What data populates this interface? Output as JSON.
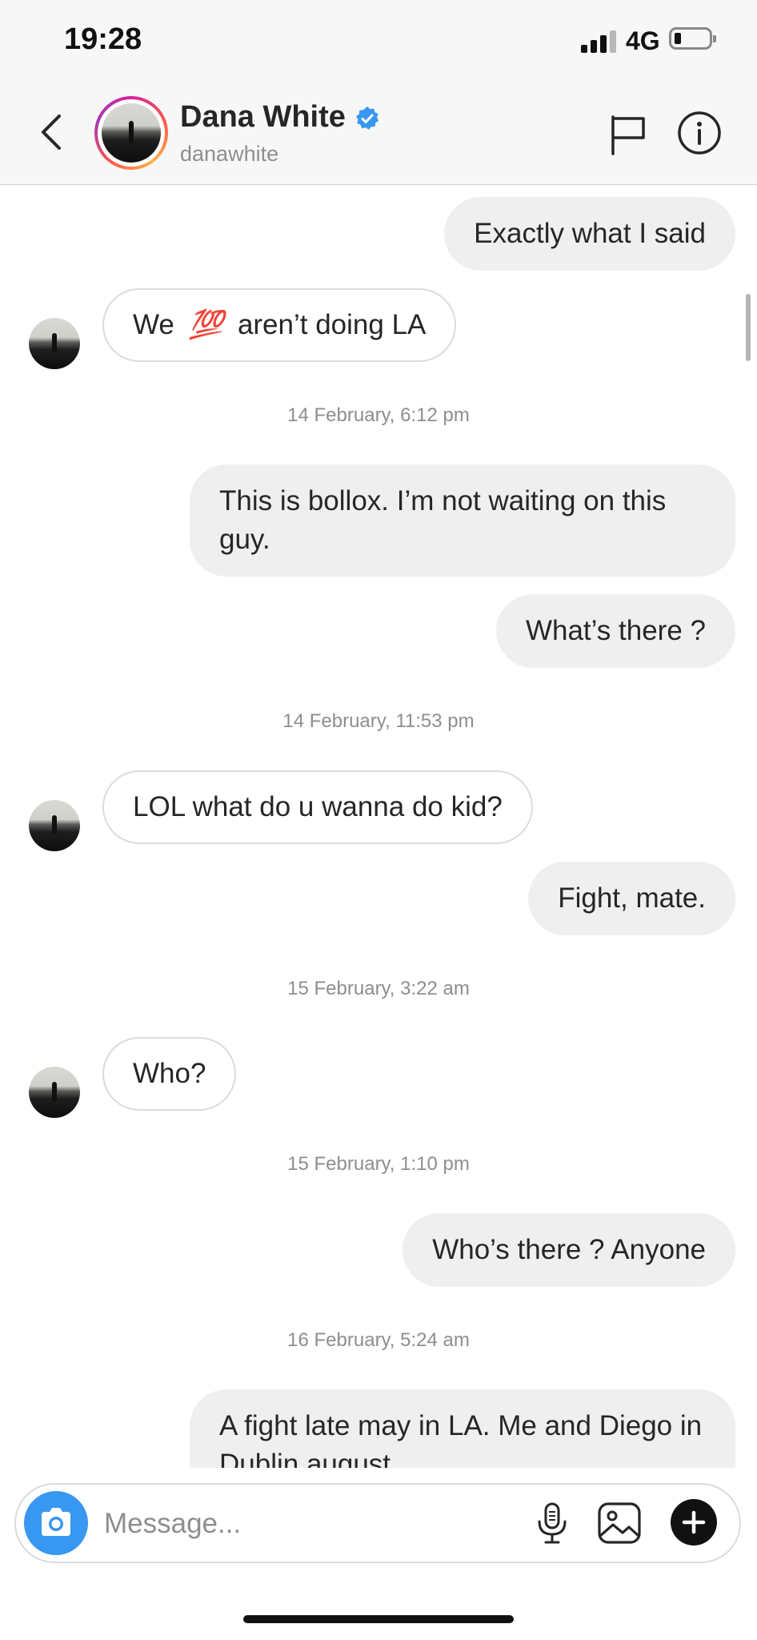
{
  "status": {
    "time": "19:28",
    "network": "4G"
  },
  "header": {
    "name": "Dana White",
    "handle": "danawhite"
  },
  "messages": {
    "m1": "Exactly what I said",
    "m2_pre": "We",
    "m2_emoji": "💯",
    "m2_post": "aren’t doing LA",
    "ts1": "14 February, 6:12 pm",
    "m3": "This is bollox. I’m not waiting on this guy.",
    "m4": "What’s there ?",
    "ts2": "14 February, 11:53 pm",
    "m5": "LOL what do u wanna do kid?",
    "m6": "Fight, mate.",
    "ts3": "15 February, 3:22 am",
    "m7": "Who?",
    "ts4": "15 February, 1:10 pm",
    "m8": "Who’s there ? Anyone",
    "ts5": "16 February, 5:24 am",
    "m9": "A fight late may in LA. Me and Diego in Dublin august"
  },
  "composer": {
    "placeholder": "Message..."
  },
  "colors": {
    "accent": "#3897f0",
    "bubble_out": "#efefef",
    "timestamp": "#8e8e8e",
    "verified": "#3897f0"
  },
  "icons": [
    "back-chevron-icon",
    "verified-badge-icon",
    "flag-icon",
    "info-icon",
    "camera-icon",
    "microphone-icon",
    "gallery-icon",
    "plus-icon"
  ]
}
